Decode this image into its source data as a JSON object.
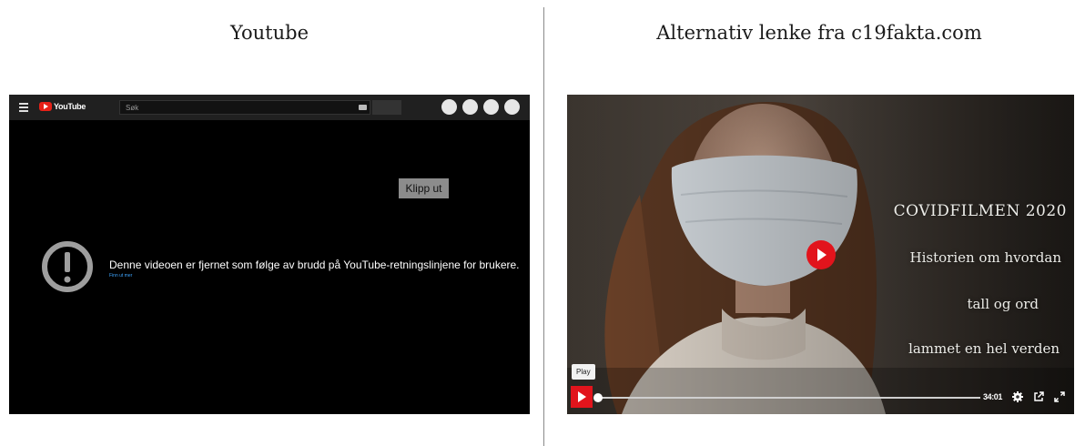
{
  "left_heading": "Youtube",
  "right_heading": "Alternativ lenke fra c19fakta.com",
  "youtube": {
    "logo_text": "YouTube",
    "search_placeholder": "Søk",
    "clip_button": "Klipp ut",
    "error_message": "Denne videoen er fjernet som følge av brudd på YouTube-retningslinjene for brukere.",
    "learn_more": "Finn ut mer",
    "colors": {
      "brand_red": "#e62117",
      "background": "#000000",
      "topbar": "#202020",
      "link": "#3ea6ff"
    }
  },
  "alternative": {
    "title": "COVIDFILMEN 2020",
    "lines": [
      "Historien om hvordan",
      "tall og ord",
      "lammet en hel verden"
    ],
    "play_tooltip": "Play",
    "duration": "34:01",
    "progress_fraction": 0,
    "colors": {
      "accent_red": "#e2141c"
    },
    "icons": [
      "play-icon",
      "settings-icon",
      "external-link-icon",
      "fullscreen-icon"
    ]
  }
}
